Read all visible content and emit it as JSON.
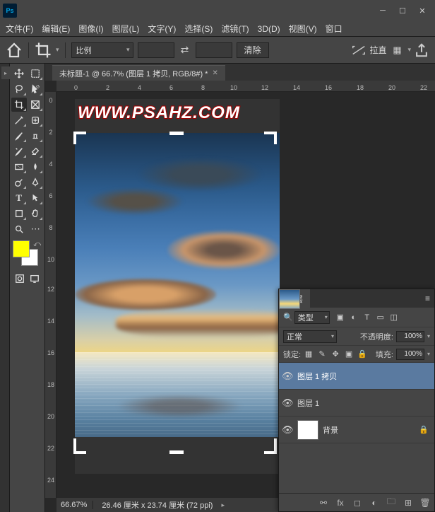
{
  "app": {
    "logo": "Ps"
  },
  "menu": [
    "文件(F)",
    "编辑(E)",
    "图像(I)",
    "图层(L)",
    "文字(Y)",
    "选择(S)",
    "滤镜(T)",
    "3D(D)",
    "视图(V)",
    "窗口"
  ],
  "options": {
    "ratio_label": "比例",
    "clear": "清除",
    "straighten": "拉直"
  },
  "document": {
    "tab_title": "未标题-1 @ 66.7% (图层 1 拷贝, RGB/8#) *",
    "watermark": "WWW.PSAHZ.COM"
  },
  "ruler_top": [
    "0",
    "2",
    "4",
    "6",
    "8",
    "10",
    "12",
    "14",
    "16",
    "18",
    "20",
    "22"
  ],
  "ruler_left": [
    "0",
    "2",
    "4",
    "6",
    "8",
    "10",
    "12",
    "14",
    "16",
    "18",
    "20",
    "22",
    "24"
  ],
  "status": {
    "zoom": "66.67%",
    "dims": "26.46 厘米 x 23.74 厘米 (72 ppi)"
  },
  "layers_panel": {
    "title": "图层",
    "filter_label": "类型",
    "blend_mode": "正常",
    "opacity_label": "不透明度:",
    "opacity_value": "100%",
    "lock_label": "锁定:",
    "fill_label": "填充:",
    "fill_value": "100%",
    "layers": [
      {
        "name": "图层 1 拷贝",
        "visible": true,
        "active": true,
        "thumb": "sky"
      },
      {
        "name": "图层 1",
        "visible": true,
        "active": false,
        "thumb": "sky"
      },
      {
        "name": "背景",
        "visible": true,
        "active": false,
        "thumb": "white",
        "locked": true
      }
    ]
  },
  "colors": {
    "fg": "#ffff00",
    "bg": "#ffffff"
  }
}
